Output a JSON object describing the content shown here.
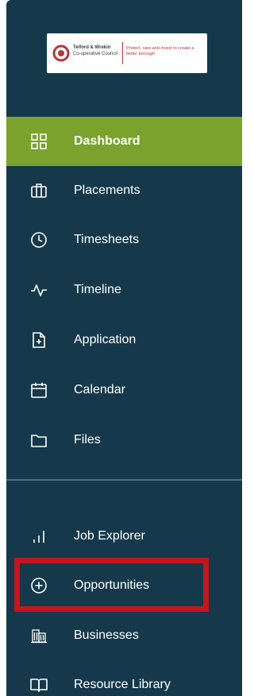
{
  "logo": {
    "org_line1": "Telford & Wrekin",
    "org_line2": "Co-operative Council",
    "tagline": "Protect, care and invest to create a better borough"
  },
  "nav": {
    "dashboard": "Dashboard",
    "placements": "Placements",
    "timesheets": "Timesheets",
    "timeline": "Timeline",
    "application": "Application",
    "calendar": "Calendar",
    "files": "Files",
    "job_explorer": "Job Explorer",
    "opportunities": "Opportunities",
    "businesses": "Businesses",
    "resource_library": "Resource Library"
  },
  "colors": {
    "sidebar_bg": "#15394a",
    "active_bg": "#7aa22d",
    "highlight": "#c4161c"
  }
}
